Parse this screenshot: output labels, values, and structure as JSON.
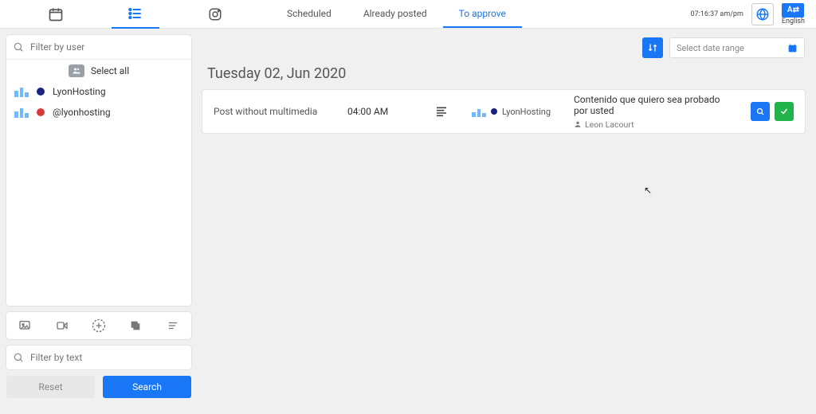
{
  "topbar": {
    "tabs": [
      {
        "label": "Scheduled",
        "active": false
      },
      {
        "label": "Already posted",
        "active": false
      },
      {
        "label": "To approve",
        "active": true
      }
    ],
    "time": "07:16:37 am/pm",
    "language": "English"
  },
  "sidebar": {
    "filter_user_placeholder": "Filter by user",
    "select_all_label": "Select all",
    "accounts": [
      {
        "name": "LyonHosting",
        "badge_color": "#1a237e"
      },
      {
        "name": "@lyonhosting",
        "badge_color": "#d63a3a"
      }
    ],
    "filter_text_placeholder": "Filter by text",
    "reset_label": "Reset",
    "search_label": "Search"
  },
  "main": {
    "date_range_placeholder": "Select date range",
    "date_heading": "Tuesday 02, Jun 2020",
    "post": {
      "kind": "Post without multimedia",
      "time": "04:00 AM",
      "account": "LyonHosting",
      "content": "Contenido que quiero sea probado por usted",
      "author": "Leon Lacourt"
    }
  }
}
